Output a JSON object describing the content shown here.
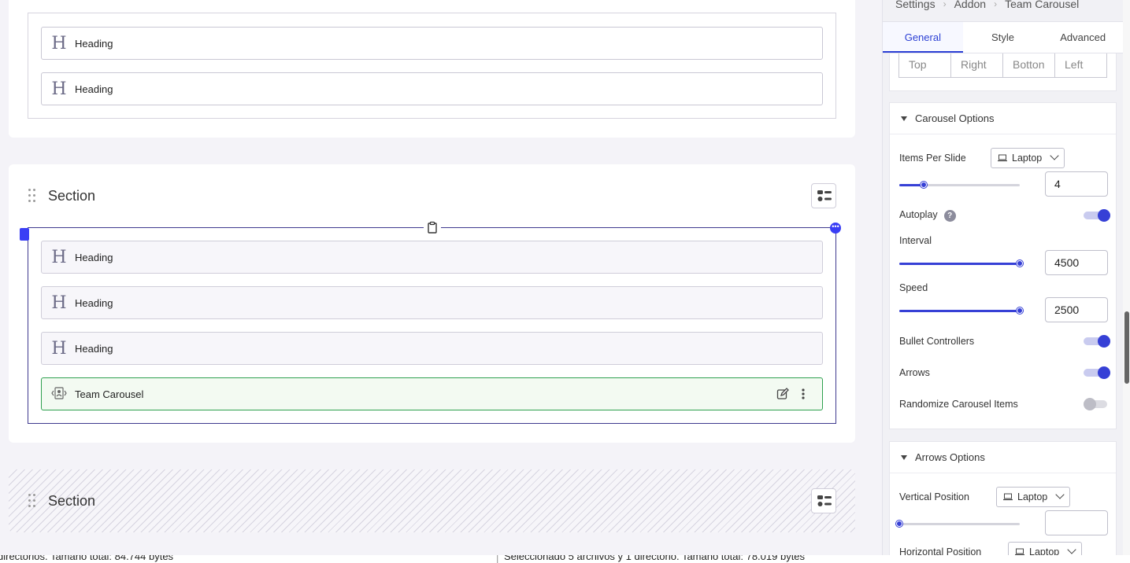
{
  "canvas": {
    "top_card": {
      "headings": [
        "Heading",
        "Heading"
      ]
    },
    "section1": {
      "title": "Section",
      "addons": [
        "Heading",
        "Heading",
        "Heading"
      ],
      "team_carousel_label": "Team Carousel"
    },
    "section2": {
      "title": "Section"
    }
  },
  "statusbar": {
    "left": "directorios. Tamaño total: 84.744 bytes",
    "right": "Seleccionado 5 archivos y 1 directorio. Tamaño total: 78.019 bytes"
  },
  "panel": {
    "breadcrumb": [
      "Settings",
      "Addon",
      "Team Carousel"
    ],
    "tabs": [
      "General",
      "Style",
      "Advanced"
    ],
    "active_tab": "General",
    "padding_placeholders": [
      "Top",
      "Right",
      "Botton",
      "Left"
    ],
    "carousel_options": {
      "title": "Carousel Options",
      "items_per_slide_label": "Items Per Slide",
      "items_per_slide_device": "Laptop",
      "items_per_slide_value": "4",
      "items_per_slide_fraction": 0.2,
      "autoplay_label": "Autoplay",
      "autoplay_help": "?",
      "autoplay_on": true,
      "interval_label": "Interval",
      "interval_value": "4500",
      "interval_fraction": 1.0,
      "speed_label": "Speed",
      "speed_value": "2500",
      "speed_fraction": 1.0,
      "bullet_label": "Bullet Controllers",
      "bullet_on": true,
      "arrows_label": "Arrows",
      "arrows_on": true,
      "randomize_label": "Randomize Carousel Items",
      "randomize_on": false
    },
    "arrows_options": {
      "title": "Arrows Options",
      "vertical_label": "Vertical Position",
      "vertical_device": "Laptop",
      "vertical_value": "",
      "horizontal_label": "Horizontal Position",
      "horizontal_device": "Laptop"
    }
  },
  "colors": {
    "accent": "#3640d6",
    "selected_border": "#3f3a8f",
    "team_border": "#2ea04f"
  }
}
